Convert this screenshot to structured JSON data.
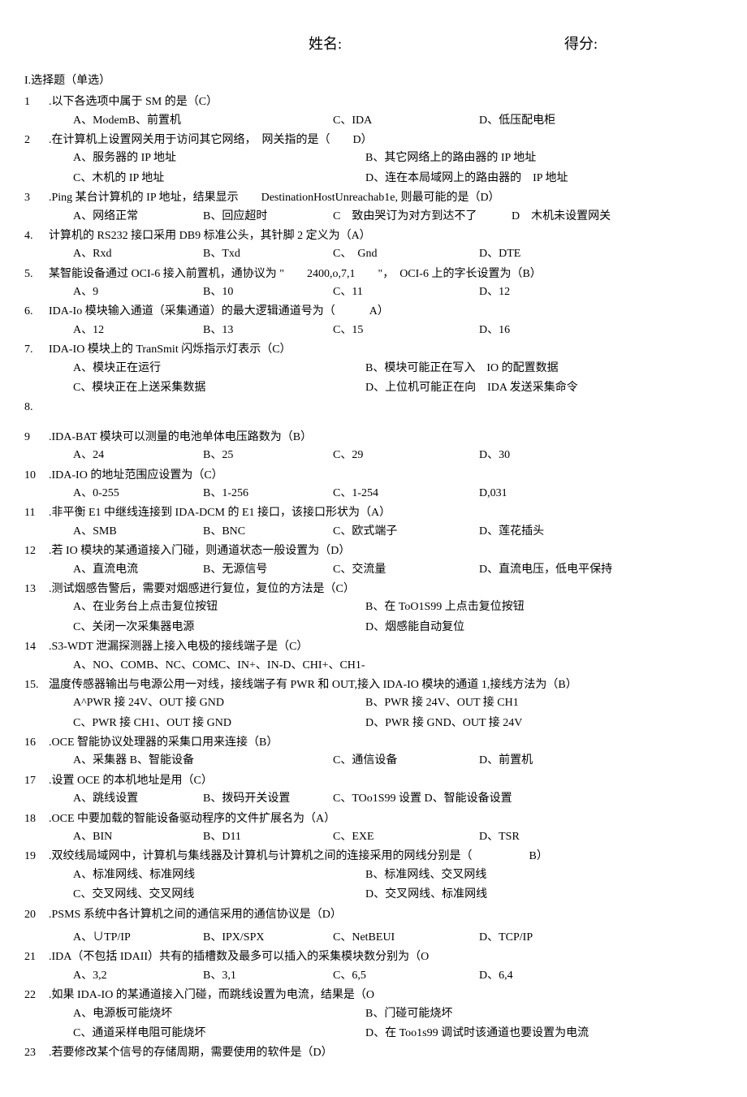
{
  "header": {
    "name_label": "姓名:",
    "score_label": "得分:"
  },
  "section_title": "I.选择题（单选）",
  "questions": [
    {
      "num": "1",
      "text": ".以下各选项中属于 SM 的是（C）",
      "options": [
        [
          "A、ModemB、前置机",
          "",
          "C、IDA",
          "D、低压配电柜"
        ]
      ]
    },
    {
      "num": "2",
      "text": ".在计算机上设置网关用于访问其它网络，　网关指的是（　　D）",
      "options": [
        [
          "A、服务器的 IP 地址",
          "B、其它网络上的路由器的 IP 地址"
        ],
        [
          "C、木机的 IP 地址",
          "D、连在本局域网上的路由器的　IP 地址"
        ]
      ]
    },
    {
      "num": "3",
      "text": ".Ping 某台计算机的 IP 地址，结果显示　　DestinationHostUnreachab1e, 则最可能的是（D）",
      "options": [
        [
          "A、网络正常",
          "B、回应超时",
          "C　致由哭订为对方到达不了",
          "D　木机未设置网关"
        ]
      ]
    },
    {
      "num": "4.",
      "text": "计算机的 RS232 接口采用 DB9 标准公头，其针脚 2 定义为（A）",
      "options": [
        [
          "A、Rxd",
          "B、Txd",
          "C、　Gnd",
          "D、DTE"
        ]
      ]
    },
    {
      "num": "5.",
      "text": "某智能设备通过 OCI-6 接入前置机，通协议为 \"　　2400,o,7,1　　\"，　OCI-6 上的字长设置为（B）",
      "options": [
        [
          "A、9",
          "B、10",
          "C、11",
          "D、12"
        ]
      ]
    },
    {
      "num": "6.",
      "text": "IDA-Io 模块输入通道（采集通道）的最大逻辑通道号为（　　　A）",
      "options": [
        [
          "A、12",
          "B、13",
          "C、15",
          "D、16"
        ]
      ]
    },
    {
      "num": "7.",
      "text": "IDA-IO 模块上的 TranSmit 闪烁指示灯表示（C）",
      "options": [
        [
          "A、模块正在运行",
          "B、模块可能正在写入　IO 的配置数据"
        ],
        [
          "C、模块正在上送采集数据",
          "D、上位机可能正在向　IDA 发送采集命令"
        ]
      ]
    },
    {
      "num": "8.",
      "text": "",
      "options": []
    },
    {
      "num": "9",
      "text": ".IDA-BAT 模块可以测量的电池单体电压路数为（B）",
      "options": [
        [
          "A、24",
          "B、25",
          "C、29",
          "D、30"
        ]
      ]
    },
    {
      "num": "10",
      "text": ".IDA-IO 的地址范围应设置为（C）",
      "options": [
        [
          "A、0-255",
          "B、1-256",
          "C、1-254",
          "D,031"
        ]
      ]
    },
    {
      "num": "11",
      "text": ".非平衡 E1 中继线连接到 IDA-DCM 的 E1 接口，该接口形状为（A）",
      "options": [
        [
          "A、SMB",
          "B、BNC",
          "C、欧式端子",
          "D、莲花插头"
        ]
      ]
    },
    {
      "num": "12",
      "text": ".若 IO 模块的某通道接入门碰，则通道状态一般设置为（D）",
      "options": [
        [
          "A、直流电流",
          "B、无源信号",
          "C、交流量",
          "D、直流电压，低电平保持"
        ]
      ]
    },
    {
      "num": "13",
      "text": ".测试烟感告警后，需要对烟感进行复位，复位的方法是（C）",
      "options": [
        [
          "A、在业务台上点击复位按钮",
          "B、在 ToO1S99 上点击复位按钮"
        ],
        [
          "C、关闭一次采集器电源",
          "D、烟感能自动复位"
        ]
      ]
    },
    {
      "num": "14",
      "text": ".S3-WDT 泄漏探测器上接入电极的接线端子是（C）",
      "options": [
        [
          "A、NO、COMB、NC、COMC、IN+、IN-D、CHI+、CH1-"
        ]
      ]
    },
    {
      "num": "15.",
      "text": "温度传感器输出与电源公用一对线，接线端子有 PWR 和 OUT,接入 IDA-IO 模块的通道 1,接线方法为（B）",
      "options": [
        [
          "A^PWR 接 24V、OUT 接 GND",
          "B、PWR 接 24V、OUT 接 CH1"
        ],
        [
          "C、PWR 接 CH1、OUT 接 GND",
          "D、PWR 接 GND、OUT 接 24V"
        ]
      ]
    },
    {
      "num": "16",
      "text": ".OCE 智能协议处理器的采集口用来连接（B）",
      "options": [
        [
          "A、采集器 B、智能设备",
          "",
          "C、通信设备",
          "D、前置机"
        ]
      ]
    },
    {
      "num": "17",
      "text": ".设置 OCE 的本机地址是用（C）",
      "options": [
        [
          "A、跳线设置",
          "B、拨码开关设置",
          "C、TOo1S99 设置 D、智能设备设置"
        ]
      ]
    },
    {
      "num": "18",
      "text": ".OCE 中要加载的智能设备驱动程序的文件扩展名为（A）",
      "options": [
        [
          "A、BIN",
          "B、D11",
          "C、EXE",
          "D、TSR"
        ]
      ]
    },
    {
      "num": "19",
      "text": ".双绞线局域网中，计算机与集线器及计算机与计算机之间的连接采用的网线分别是（　　　　　B）",
      "options": [
        [
          "A、标准网线、标准网线",
          "B、标准网线、交叉网线"
        ],
        [
          "C、交叉网线、交叉网线",
          "D、交叉网线、标准网线"
        ]
      ]
    },
    {
      "num": "20",
      "text": ".PSMS 系统中各计算机之间的通信采用的通信协议是（D）",
      "options": [
        [
          "A、∪TP/IP",
          "B、IPX/SPX",
          "C、NetBEUI",
          "D、TCP/IP"
        ]
      ]
    },
    {
      "num": "21",
      "text": ".IDA（不包括 IDAII）共有的插槽数及最多可以插入的采集模块数分别为（O",
      "options": [
        [
          "A、3,2",
          "B、3,1",
          "C、6,5",
          "D、6,4"
        ]
      ]
    },
    {
      "num": "22",
      "text": ".如果 IDA-IO 的某通道接入门碰，而跳线设置为电流，结果是（O",
      "options": [
        [
          "A、电源板可能烧坏",
          "B、门碰可能烧坏"
        ],
        [
          "C、通道采样电阻可能烧坏",
          "D、在 Too1s99 调试时该通道也要设置为电流"
        ]
      ]
    },
    {
      "num": "23",
      "text": ".若要修改某个信号的存储周期，需要使用的软件是（D）",
      "options": []
    }
  ]
}
